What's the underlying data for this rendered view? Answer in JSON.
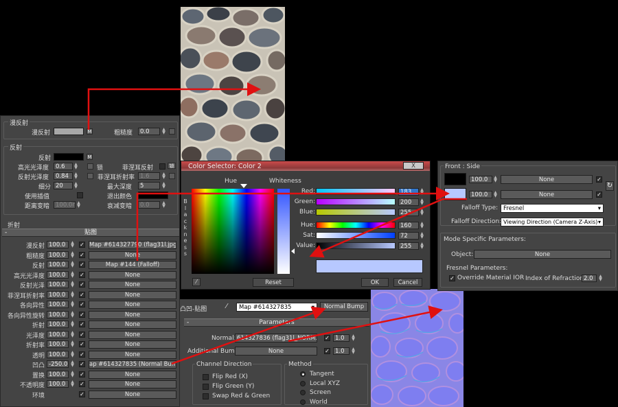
{
  "colors": {
    "accent_red": "#e01010",
    "panel_bg": "#444444",
    "dialog_bg": "#3d3d3d"
  },
  "diffuse": {
    "title": "漫反射",
    "diffuse_label": "漫反射",
    "m_label": "M",
    "roughness_label": "粗糙度",
    "roughness": "0.0"
  },
  "reflection": {
    "title": "反射",
    "reflect_label": "反射",
    "m_label": "M",
    "hilight_label": "高光光泽度",
    "hilight": "0.6",
    "lock_label": "锁",
    "fresnel_label": "菲涅耳反射",
    "refl_gloss_label": "反射光泽度",
    "refl_gloss": "0.84",
    "fresnel_ior_label": "菲涅耳折射率",
    "fresnel_ior": "1.6",
    "subdivs_label": "细分",
    "subdivs": "20",
    "max_depth_label": "最大深度",
    "max_depth": "5",
    "interp_label": "使用插值",
    "exit_color_label": "退出颜色",
    "dim_dist_label": "距离变暗",
    "dim_dist": "100.0m",
    "dim_falloff_label": "衰减变暗",
    "dim_falloff": "0.0"
  },
  "refraction": {
    "title": "折射"
  },
  "maps": {
    "title": "贴图",
    "minus": "-",
    "rows": [
      {
        "label": "漫反射",
        "amount": "100.0",
        "check": "✓",
        "map": "Map #614327790 (flag31l.jpg)"
      },
      {
        "label": "粗糙度",
        "amount": "100.0",
        "check": "✓",
        "map": "None"
      },
      {
        "label": "反射",
        "amount": "100.0",
        "check": "✓",
        "map": "Map #144  (Falloff)"
      },
      {
        "label": "高光光泽度",
        "amount": "100.0",
        "check": "✓",
        "map": "None"
      },
      {
        "label": "反射光泽",
        "amount": "100.0",
        "check": "✓",
        "map": "None"
      },
      {
        "label": "菲涅耳折射率",
        "amount": "100.0",
        "check": "✓",
        "map": "None"
      },
      {
        "label": "各向异性",
        "amount": "100.0",
        "check": "✓",
        "map": "None"
      },
      {
        "label": "各向异性旋转",
        "amount": "100.0",
        "check": "✓",
        "map": "None"
      },
      {
        "label": "折射",
        "amount": "100.0",
        "check": "✓",
        "map": "None"
      },
      {
        "label": "光泽度",
        "amount": "100.0",
        "check": "✓",
        "map": "None"
      },
      {
        "label": "折射率",
        "amount": "100.0",
        "check": "✓",
        "map": "None"
      },
      {
        "label": "透明",
        "amount": "100.0",
        "check": "✓",
        "map": "None"
      },
      {
        "label": "凹凸",
        "amount": "-250.0",
        "check": "✓",
        "map": "ap #614327835  (Normal Bump )"
      },
      {
        "label": "置换",
        "amount": "100.0",
        "check": "✓",
        "map": "None"
      },
      {
        "label": "不透明度",
        "amount": "100.0",
        "check": "✓",
        "map": "None"
      },
      {
        "label": "环境",
        "amount": "",
        "check": "✓",
        "map": "None"
      }
    ]
  },
  "color_selector": {
    "title": "Color Selector: Color 2",
    "hue_label": "Hue",
    "whiteness_label": "Whiteness",
    "blackness_label": "B\nl\na\nc\nk\nn\ne\ns\ns",
    "channels": [
      {
        "label": "Red:",
        "value": "183"
      },
      {
        "label": "Green:",
        "value": "200"
      },
      {
        "label": "Blue:",
        "value": "255"
      },
      {
        "label": "Hue:",
        "value": "160"
      },
      {
        "label": "Sat:",
        "value": "72"
      },
      {
        "label": "Value:",
        "value": "255"
      }
    ],
    "reset": "Reset",
    "ok": "OK",
    "cancel": "Cancel",
    "close": "X",
    "swatch_color": "#b7c8ff"
  },
  "falloff": {
    "header": "Front : Side",
    "front_amount": "100.0",
    "front_map": "None",
    "side_amount": "100.0",
    "side_map": "None",
    "type_label": "Falloff Type:",
    "type_value": "Fresnel",
    "dir_label": "Falloff Direction:",
    "dir_value": "Viewing Direction (Camera Z-Axis)",
    "mode_title": "Mode Specific Parameters:",
    "object_label": "Object:",
    "object_value": "None",
    "fresnel_title": "Fresnel Parameters:",
    "override_label": "Override Material IOR",
    "ior_label": "Index of Refraction",
    "ior": "2.0"
  },
  "normal_bump": {
    "map_label": "凸凹-贴图",
    "map_name": "Map #614327835",
    "type": "Normal Bump",
    "params_title": "Parameters",
    "normal_label": "Normal:",
    "normal_map": "614327836 (flag31l_NORM.tga)",
    "normal_amount": "1.0",
    "add_bump_label": "Additional Bump:",
    "add_bump_map": "None",
    "add_bump_amount": "1.0",
    "channel_title": "Channel Direction",
    "flip_red": "Flip Red (X)",
    "flip_green": "Flip Green (Y)",
    "swap": "Swap Red & Green",
    "method_title": "Method",
    "method_options": [
      "Tangent",
      "Local XYZ",
      "Screen",
      "World"
    ]
  }
}
